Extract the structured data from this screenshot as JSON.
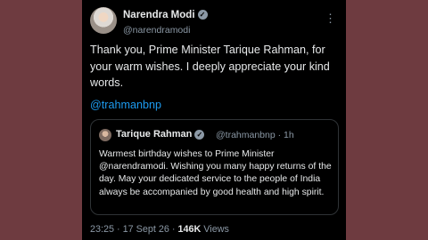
{
  "author": {
    "name": "Narendra Modi",
    "handle": "@narendramodi"
  },
  "tweet": {
    "text": "Thank you, Prime Minister Tarique Rahman, for your warm wishes. I deeply appreciate your kind words.",
    "mention": "@trahmanbnp"
  },
  "quoted": {
    "name": "Tarique Rahman",
    "handle": "@trahmanbnp",
    "time": "1h",
    "text": "Warmest birthday wishes to Prime Minister @narendramodi. Wishing you many happy returns of the day. May your dedicated service to the people of India always be accompanied by good health and high spirit."
  },
  "meta": {
    "time": "23:25",
    "date": "17 Sept 26",
    "views_count": "146K",
    "views_label": "Views"
  },
  "icons": {
    "verified": "verified-badge-icon",
    "more": "more-icon"
  },
  "colors": {
    "background": "#6e3b40",
    "card": "#000000",
    "link": "#1d9bf0",
    "muted": "#8b98a5"
  }
}
